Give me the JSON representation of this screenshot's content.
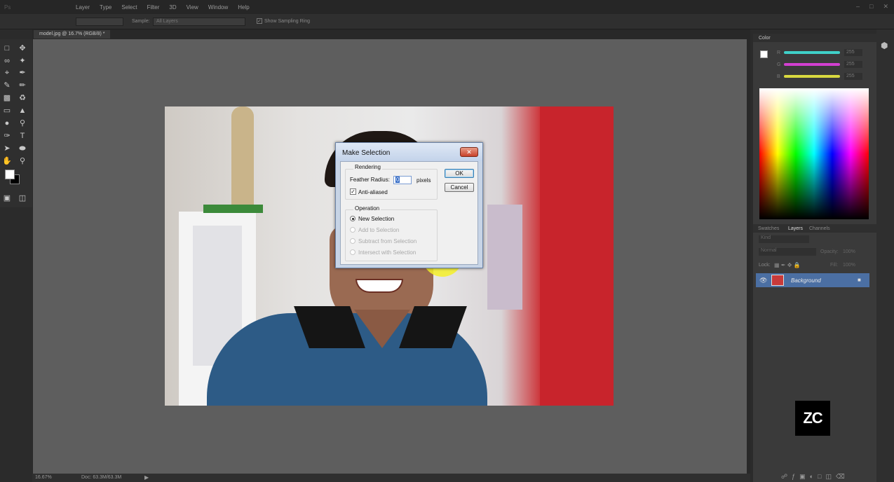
{
  "menu": {
    "items": [
      "Layer",
      "Type",
      "Select",
      "Filter",
      "3D",
      "View",
      "Window",
      "Help"
    ]
  },
  "options_bar": {
    "sample_label": "Sample:",
    "sample_value": "All Layers",
    "show_ring_label": "Show Sampling Ring"
  },
  "document": {
    "tab_title": "model.jpg @ 16.7% (RGB/8) *",
    "zoom": "16.67%",
    "doc_info": "Doc: 63.3M/63.3M"
  },
  "dialog": {
    "title": "Make Selection",
    "rendering_label": "Rendering",
    "feather_label": "Feather Radius:",
    "feather_value": "0",
    "feather_unit": "pixels",
    "antialiased_label": "Anti-aliased",
    "antialiased_checked": true,
    "operation_label": "Operation",
    "operations": [
      "New Selection",
      "Add to Selection",
      "Subtract from Selection",
      "Intersect with Selection"
    ],
    "ok_label": "OK",
    "cancel_label": "Cancel"
  },
  "color_panel": {
    "tab": "Color",
    "channels": [
      {
        "name": "R",
        "value": "255",
        "color": "#3fd0c8"
      },
      {
        "name": "G",
        "value": "255",
        "color": "#d23fd0"
      },
      {
        "name": "B",
        "value": "255",
        "color": "#d8d83f"
      }
    ]
  },
  "layers_panel": {
    "tabs": [
      "Swatches",
      "Layers",
      "Channels"
    ],
    "kind_label": "Kind",
    "blend_mode": "Normal",
    "opacity_label": "Opacity:",
    "opacity_value": "100%",
    "lock_label": "Lock:",
    "fill_label": "Fill:",
    "fill_value": "100%",
    "layers": [
      {
        "name": "Background"
      }
    ]
  },
  "watermark": {
    "text": "ZC"
  }
}
